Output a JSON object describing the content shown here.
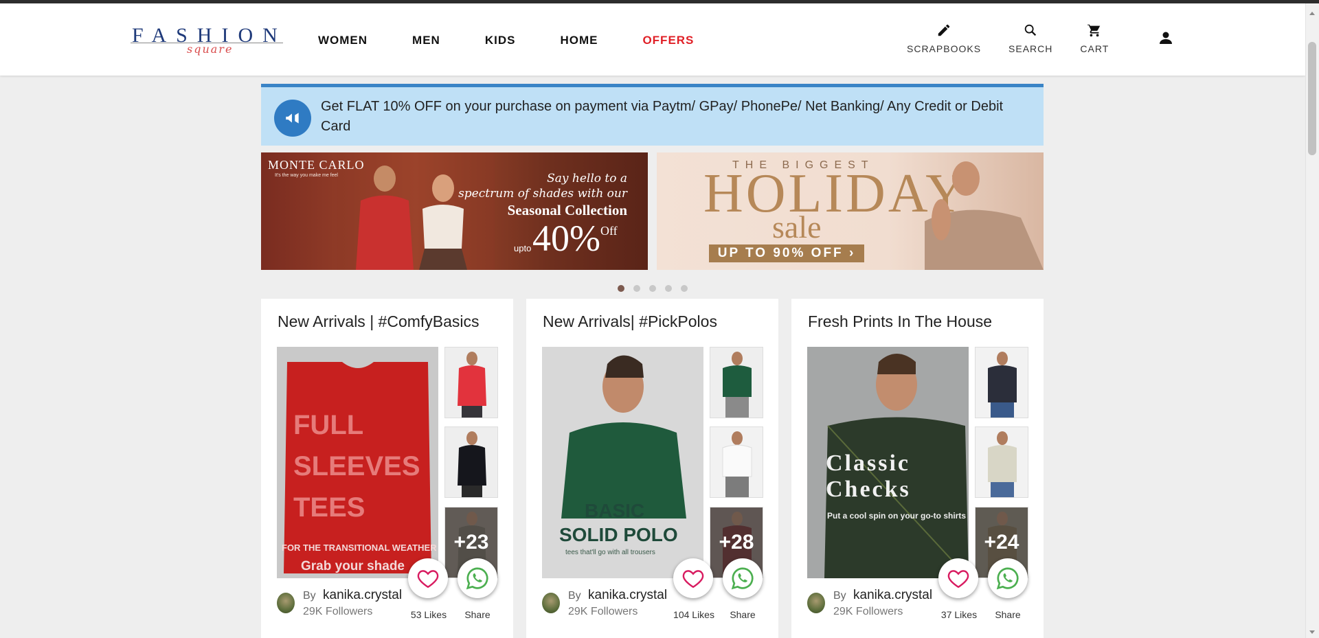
{
  "header": {
    "logo_main": "FASHION",
    "logo_sub": "square",
    "nav": [
      "WOMEN",
      "MEN",
      "KIDS",
      "HOME",
      "OFFERS"
    ],
    "actions": [
      {
        "label": "SCRAPBOOKS",
        "icon": "pencil-icon"
      },
      {
        "label": "SEARCH",
        "icon": "search-icon"
      },
      {
        "label": "CART",
        "icon": "cart-icon"
      }
    ],
    "user_icon": "user-icon"
  },
  "offer": {
    "text": "Get FLAT 10% OFF on your purchase on payment via Paytm/ GPay/ PhonePe/ Net Banking/ Any Credit or Debit Card",
    "icon": "megaphone-icon"
  },
  "promos": [
    {
      "brand": "MONTE CARLO",
      "brand_tag": "It's the way you make me feel",
      "line1": "Say hello to a",
      "line2": "spectrum of shades with our",
      "line3": "Seasonal Collection",
      "upto": "upto",
      "percent": "40%",
      "off": "Off"
    },
    {
      "the": "THE BIGGEST",
      "holiday": "HOLIDAY",
      "sale": "sale",
      "upto": "UP TO 90% OFF ›"
    }
  ],
  "carousel": {
    "dots": 5,
    "active": 0
  },
  "cards": [
    {
      "title": "New Arrivals | #ComfyBasics",
      "main_line1": "FULL",
      "main_line2": "SLEEVES",
      "main_line3": "TEES",
      "main_caption": "FOR THE TRANSITIONAL WEATHER",
      "main_cta": "Grab your shade",
      "more": "+23",
      "by": "By",
      "author": "kanika.crystal",
      "followers": "29K Followers",
      "likes": "53 Likes",
      "share": "Share"
    },
    {
      "title": "New Arrivals| #PickPolos",
      "main_line1": "BASIC",
      "main_line2": "SOLID POLO",
      "main_caption": "tees that'll go with all trousers",
      "more": "+28",
      "by": "By",
      "author": "kanika.crystal",
      "followers": "29K Followers",
      "likes": "104 Likes",
      "share": "Share"
    },
    {
      "title": "Fresh Prints In The House",
      "main_line1": "Classic",
      "main_line2": "Checks",
      "main_caption": "Put a cool spin on your go-to shirts",
      "more": "+24",
      "by": "By",
      "author": "kanika.crystal",
      "followers": "29K Followers",
      "likes": "37 Likes",
      "share": "Share"
    }
  ],
  "colors": {
    "offers_red": "#e01f26",
    "offer_bg": "#bfe0f6",
    "offer_accent": "#3a84c6",
    "like_pink": "#d81b60",
    "whatsapp_green": "#4caf50"
  }
}
